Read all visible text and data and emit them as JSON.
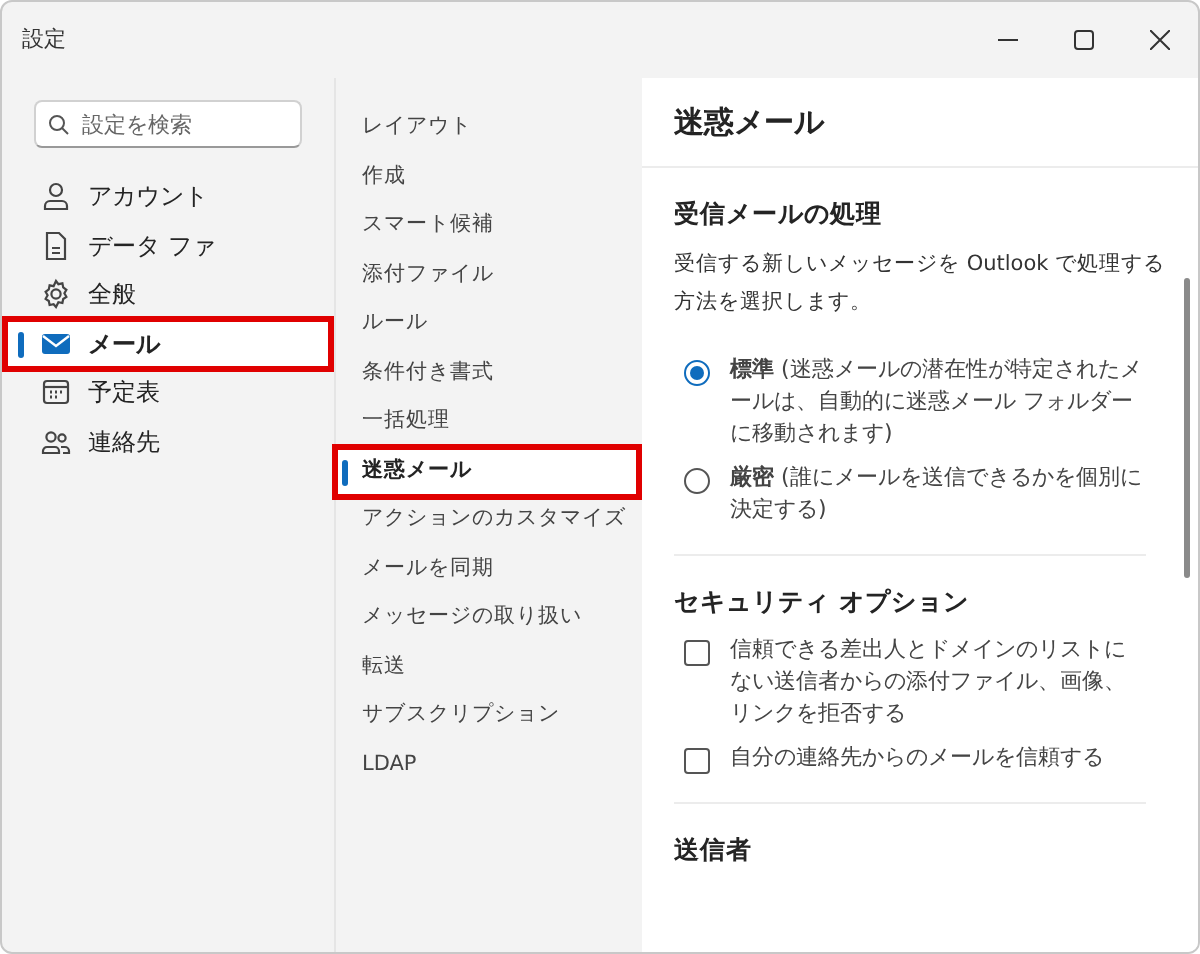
{
  "window": {
    "title": "設定"
  },
  "search": {
    "placeholder": "設定を検索"
  },
  "nav": [
    {
      "label": "アカウント",
      "selected": false,
      "highlighted": false
    },
    {
      "label": "データ ファ",
      "selected": false,
      "highlighted": false
    },
    {
      "label": "全般",
      "selected": false,
      "highlighted": false
    },
    {
      "label": "メール",
      "selected": true,
      "highlighted": true
    },
    {
      "label": "予定表",
      "selected": false,
      "highlighted": false
    },
    {
      "label": "連絡先",
      "selected": false,
      "highlighted": false
    }
  ],
  "subnav": [
    {
      "label": "レイアウト",
      "selected": false,
      "highlighted": false
    },
    {
      "label": "作成",
      "selected": false,
      "highlighted": false
    },
    {
      "label": "スマート候補",
      "selected": false,
      "highlighted": false
    },
    {
      "label": "添付ファイル",
      "selected": false,
      "highlighted": false
    },
    {
      "label": "ルール",
      "selected": false,
      "highlighted": false
    },
    {
      "label": "条件付き書式",
      "selected": false,
      "highlighted": false
    },
    {
      "label": "一括処理",
      "selected": false,
      "highlighted": false
    },
    {
      "label": "迷惑メール",
      "selected": true,
      "highlighted": true
    },
    {
      "label": "アクションのカスタマイズ",
      "selected": false,
      "highlighted": false
    },
    {
      "label": "メールを同期",
      "selected": false,
      "highlighted": false
    },
    {
      "label": "メッセージの取り扱い",
      "selected": false,
      "highlighted": false
    },
    {
      "label": "転送",
      "selected": false,
      "highlighted": false
    },
    {
      "label": "サブスクリプション",
      "selected": false,
      "highlighted": false
    },
    {
      "label": "LDAP",
      "selected": false,
      "highlighted": false
    }
  ],
  "pane": {
    "title": "迷惑メール",
    "sections": [
      {
        "title": "受信メールの処理",
        "description": "受信する新しいメッセージを Outlook で処理する方法を選択します。",
        "options": [
          {
            "kind": "radio",
            "label": "**標準** (迷惑メールの潜在性が特定されたメールは、自動的に迷惑メール フォルダーに移動されます)",
            "selected": true
          },
          {
            "kind": "radio",
            "label": "**厳密** (誰にメールを送信できるかを個別に決定する)",
            "selected": false
          }
        ]
      },
      {
        "title": "セキュリティ オプション",
        "options": [
          {
            "kind": "checkbox",
            "label": "信頼できる差出人とドメインのリストにない送信者からの添付ファイル、画像、リンクを拒否する",
            "checked": false
          },
          {
            "kind": "checkbox",
            "label": "自分の連絡先からのメールを信頼する",
            "checked": false
          }
        ]
      },
      {
        "title": "送信者"
      }
    ]
  }
}
